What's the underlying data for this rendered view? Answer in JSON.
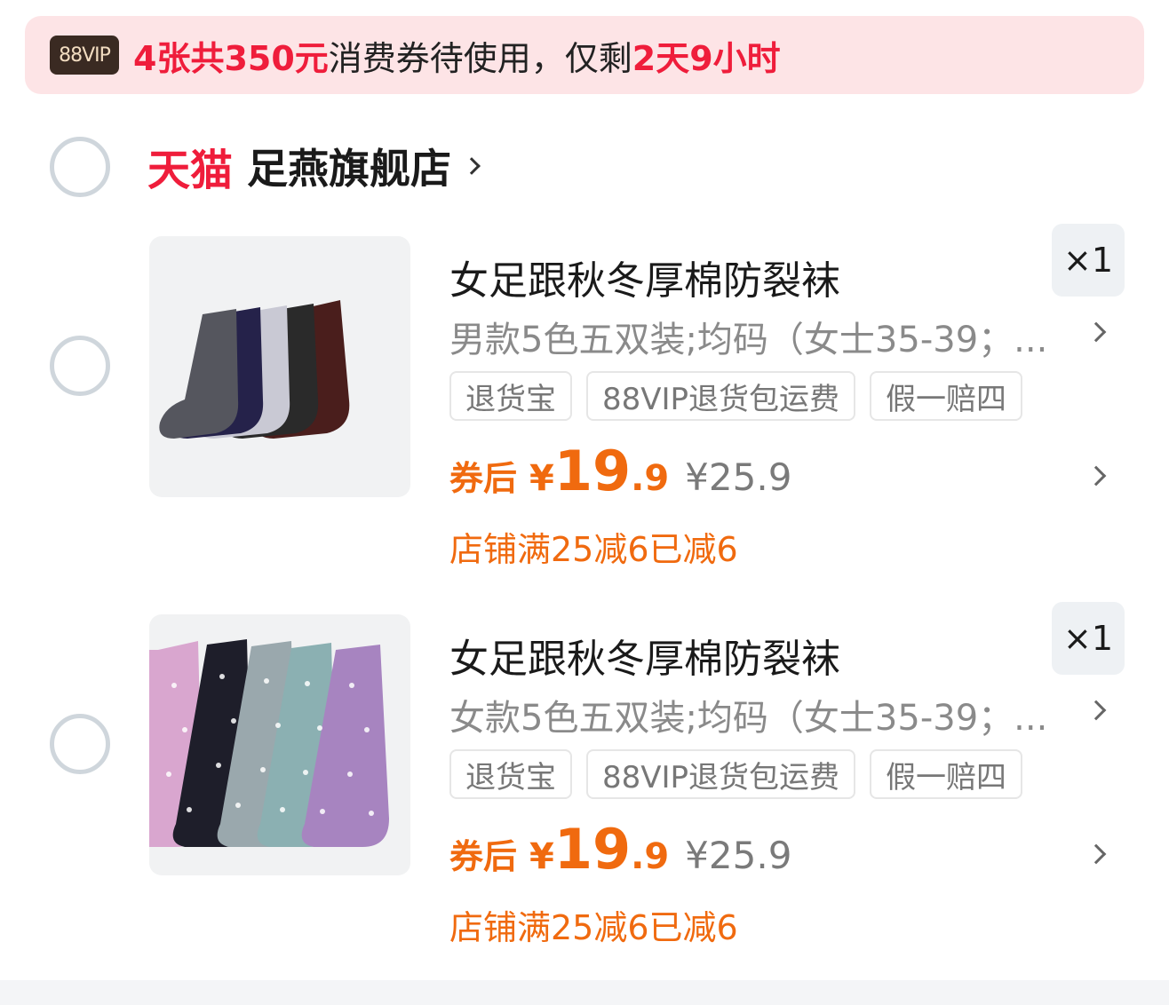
{
  "banner": {
    "badge": "88VIP",
    "count_text": "4张共350元",
    "middle_text": "消费券待使用，仅剩",
    "time_left": "2天9小时"
  },
  "shop": {
    "platform": "天猫",
    "name": "足燕旗舰店"
  },
  "items": [
    {
      "title": "女足跟秋冬厚棉防裂袜",
      "qty": "×1",
      "spec": "男款5色五双装;均码（女士35-39；...",
      "tags": [
        "退货宝",
        "88VIP退货包运费",
        "假一赔四"
      ],
      "coupon_label": "券后",
      "currency": "¥",
      "price_int": "19",
      "price_dec": ".9",
      "original_price": "¥25.9",
      "promo": "店铺满25减6已减6",
      "image": "socks-dark-icon"
    },
    {
      "title": "女足跟秋冬厚棉防裂袜",
      "qty": "×1",
      "spec": "女款5色五双装;均码（女士35-39；...",
      "tags": [
        "退货宝",
        "88VIP退货包运费",
        "假一赔四"
      ],
      "coupon_label": "券后",
      "currency": "¥",
      "price_int": "19",
      "price_dec": ".9",
      "original_price": "¥25.9",
      "promo": "店铺满25减6已减6",
      "image": "socks-dotted-icon"
    }
  ],
  "colors": {
    "accent_red": "#ef1d3b",
    "price_orange": "#f06a0f",
    "banner_bg": "#fde4e6"
  }
}
